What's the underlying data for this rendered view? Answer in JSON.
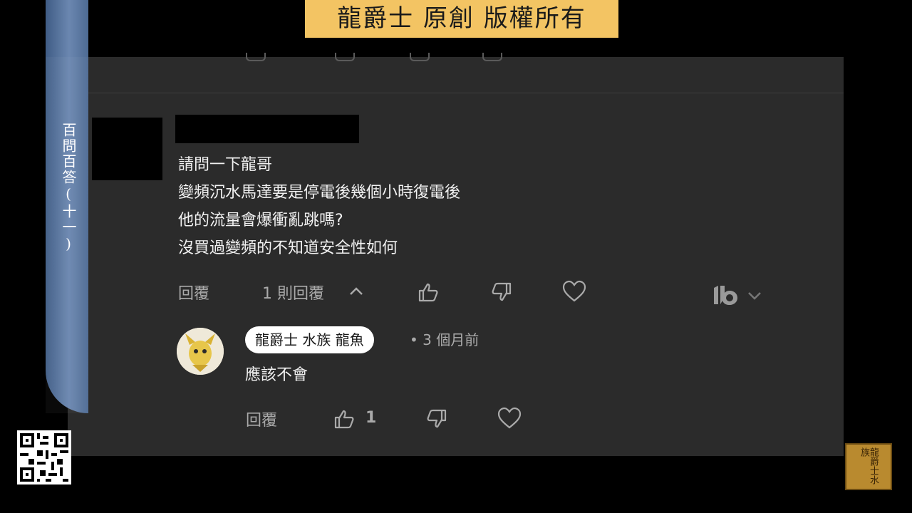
{
  "banner": {
    "text": "龍爵士 原創 版權所有"
  },
  "side_title": "百問百答(十一)",
  "comment": {
    "lines": [
      "請問一下龍哥",
      "變頻沉水馬達要是停電後幾個小時復電後",
      "他的流量會爆衝亂跳嗎?",
      "沒買過變頻的不知道安全性如何"
    ],
    "actions": {
      "reply_label": "回覆",
      "replies_label": "1 則回覆"
    }
  },
  "reply": {
    "author": "龍爵士 水族 龍魚",
    "timestamp": "• 3 個月前",
    "text": "應該不會",
    "actions": {
      "reply_label": "回覆",
      "like_count": "1"
    }
  },
  "seal": {
    "text": "龍爵士水族"
  },
  "icons": [
    "chevron-up-icon",
    "thumb-up-icon",
    "thumb-down-icon",
    "heart-icon",
    "creator-logo-icon",
    "chevron-down-icon",
    "qr-code-icon",
    "seal-stamp-icon"
  ]
}
